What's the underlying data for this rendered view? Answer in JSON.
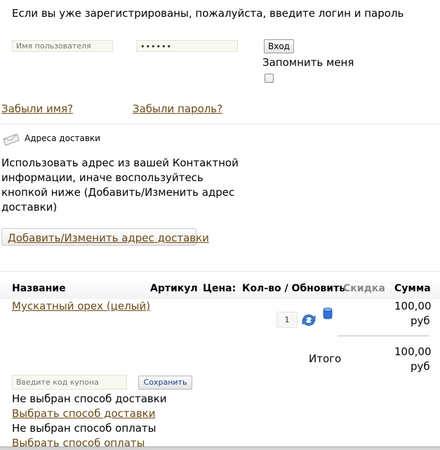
{
  "login": {
    "intro": "Если вы уже зарегистрированы, пожалуйста, введите логин и пароль",
    "username_placeholder": "Имя пользователя",
    "password_value": "••••••",
    "login_button": "Вход",
    "remember_label": "Запомнить меня",
    "forgot_name": "Забыли имя?",
    "forgot_password": "Забыли пароль?"
  },
  "shipping": {
    "title": "Адреса доставки",
    "note_lines": [
      "Использовать адрес из вашей Контактной",
      "информации, иначе воспользуйтесь",
      "кнопкой ниже (Добавить/Изменить адрес",
      "доставки)"
    ],
    "add_button": "Добавить/Изменить адрес доставки"
  },
  "cart": {
    "headers": {
      "name": "Название",
      "sku": "Артикул",
      "price": "Цена:",
      "qty": "Кол-во / Обновить",
      "discount": "Скидка",
      "sum": "Сумма"
    },
    "item": {
      "name": "Мускатный орех (целый)",
      "qty": "1",
      "sum_amount": "100,00",
      "sum_currency": "руб"
    },
    "total_label": "Итого",
    "total_amount": "100,00",
    "total_currency": "руб",
    "coupon_placeholder": "Введите код купона",
    "coupon_button": "Сохранить",
    "no_shipping": "Не выбран способ доставки",
    "choose_shipping": "Выбрать способ доставки",
    "no_payment": "Не выбран способ оплаты",
    "choose_payment": "Выбрать способ оплаты"
  },
  "colors": {
    "link": "#6b4a16",
    "input_bg": "#f7f8f0",
    "discount_header": "#888888"
  }
}
